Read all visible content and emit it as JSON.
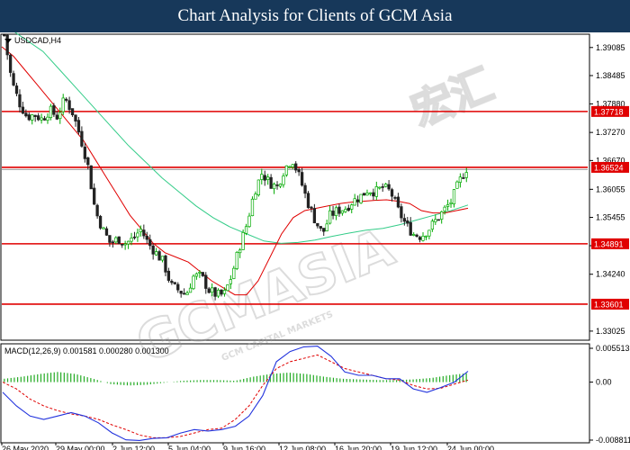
{
  "header": {
    "title": "Chart Analysis for Clients of GCM Asia"
  },
  "watermark": {
    "text": "GCMASIA",
    "cn": "宏汇",
    "subtitle": "GCM CAPITAL MARKETS"
  },
  "colors": {
    "bull": "#00aa00",
    "bear": "#222222",
    "ma_fast": "#e00000",
    "ma_slow": "#33cc88",
    "level_line": "#e00000",
    "level_label_bg": "#e00000",
    "macd_line": "#2233dd",
    "signal_line": "#e00000",
    "histogram": "#22aa22",
    "price_line": "#777777"
  },
  "chart_data": [
    {
      "type": "candlestick",
      "symbol": "USDCAD,H4",
      "ylim": [
        1.3285,
        1.3935
      ],
      "y_ticks": [
        "1.39085",
        "1.38485",
        "1.37880",
        "1.37270",
        "1.36670",
        "1.36055",
        "1.35455",
        "1.34850",
        "1.34240",
        "1.33025"
      ],
      "x_ticks": [
        "26 May 2020",
        "29 May 00:00",
        "2 Jun 12:00",
        "5 Jun 04:00",
        "9 Jun 16:00",
        "12 Jun 08:00",
        "16 Jun 20:00",
        "19 Jun 12:00",
        "24 Jun 00:00"
      ],
      "levels": [
        {
          "value": 1.37718,
          "label": "1.37718"
        },
        {
          "value": 1.36524,
          "label": "1.36524"
        },
        {
          "value": 1.34891,
          "label": "1.34891"
        },
        {
          "value": 1.33601,
          "label": "1.33601"
        }
      ],
      "current_price": 1.3648,
      "close_path": [
        1.3935,
        1.3835,
        1.379,
        1.376,
        1.3765,
        1.3755,
        1.3775,
        1.376,
        1.38,
        1.377,
        1.372,
        1.366,
        1.356,
        1.352,
        1.349,
        1.35,
        1.349,
        1.35,
        1.352,
        1.349,
        1.347,
        1.345,
        1.34,
        1.339,
        1.338,
        1.342,
        1.342,
        1.339,
        1.338,
        1.338,
        1.342,
        1.348,
        1.353,
        1.36,
        1.364,
        1.362,
        1.361,
        1.365,
        1.367,
        1.363,
        1.358,
        1.354,
        1.351,
        1.355,
        1.356,
        1.3565,
        1.358,
        1.359,
        1.3605,
        1.36,
        1.361,
        1.36,
        1.356,
        1.353,
        1.351,
        1.3505,
        1.352,
        1.354,
        1.356,
        1.358,
        1.362,
        1.365
      ],
      "ma_fast": [
        1.391,
        1.389,
        1.386,
        1.383,
        1.38,
        1.377,
        1.374,
        1.371,
        1.367,
        1.363,
        1.359,
        1.355,
        1.352,
        1.349,
        1.347,
        1.346,
        1.345,
        1.343,
        1.341,
        1.3395,
        1.338,
        1.338,
        1.341,
        1.346,
        1.351,
        1.3545,
        1.356,
        1.3565,
        1.357,
        1.3575,
        1.3578,
        1.358,
        1.3582,
        1.3583,
        1.358,
        1.3575,
        1.356,
        1.3555,
        1.3555,
        1.356,
        1.3565
      ],
      "ma_slow": [
        1.395,
        1.3925,
        1.39,
        1.386,
        1.382,
        1.378,
        1.374,
        1.37,
        1.3665,
        1.363,
        1.36,
        1.357,
        1.3545,
        1.3525,
        1.351,
        1.3495,
        1.349,
        1.3492,
        1.3497,
        1.3505,
        1.3512,
        1.3518,
        1.3522,
        1.353,
        1.354,
        1.355,
        1.356,
        1.3572
      ],
      "macd": {
        "label": "MACD(12,26,9) 0.001581 0.000280 0.001300",
        "ylim": [
          -0.008811,
          0.005513
        ],
        "y_ticks": [
          "0.005513",
          "0.00",
          "-0.008811"
        ],
        "main": [
          -0.0015,
          -0.0035,
          -0.005,
          -0.0055,
          -0.005,
          -0.0045,
          -0.005,
          -0.006,
          -0.0075,
          -0.0085,
          -0.0086,
          -0.0083,
          -0.0082,
          -0.0075,
          -0.007,
          -0.0072,
          -0.007,
          -0.0065,
          -0.005,
          -0.002,
          0.003,
          0.0045,
          0.0052,
          0.0053,
          0.0038,
          0.0015,
          0.001,
          0.001,
          0.0005,
          0.0005,
          -0.001,
          -0.0015,
          -0.0008,
          0.0,
          0.0016
        ],
        "signal": [
          0.0,
          -0.001,
          -0.0025,
          -0.0035,
          -0.0042,
          -0.0047,
          -0.005,
          -0.0055,
          -0.0063,
          -0.007,
          -0.0078,
          -0.0082,
          -0.0082,
          -0.008,
          -0.0075,
          -0.007,
          -0.0068,
          -0.0055,
          -0.0035,
          -0.0005,
          0.002,
          0.003,
          0.0035,
          0.004,
          0.003,
          0.002,
          0.0015,
          0.001,
          0.0005,
          0.0003,
          -0.0005,
          -0.001,
          -0.0009,
          -0.0003,
          0.0003
        ],
        "hist_amplitude": [
          0.0005,
          0.0008,
          0.0012,
          0.0015,
          0.0012,
          0.0005,
          -0.0003,
          -0.0005,
          -0.0004,
          -0.0001,
          0.0002,
          0.0003,
          0.0003,
          0.0002,
          0.0008,
          0.0012,
          0.0014,
          0.0012,
          0.0008,
          0.0005,
          0.0004,
          0.0003,
          0.0003,
          0.0004,
          0.0006,
          0.001,
          0.0013
        ]
      }
    }
  ]
}
